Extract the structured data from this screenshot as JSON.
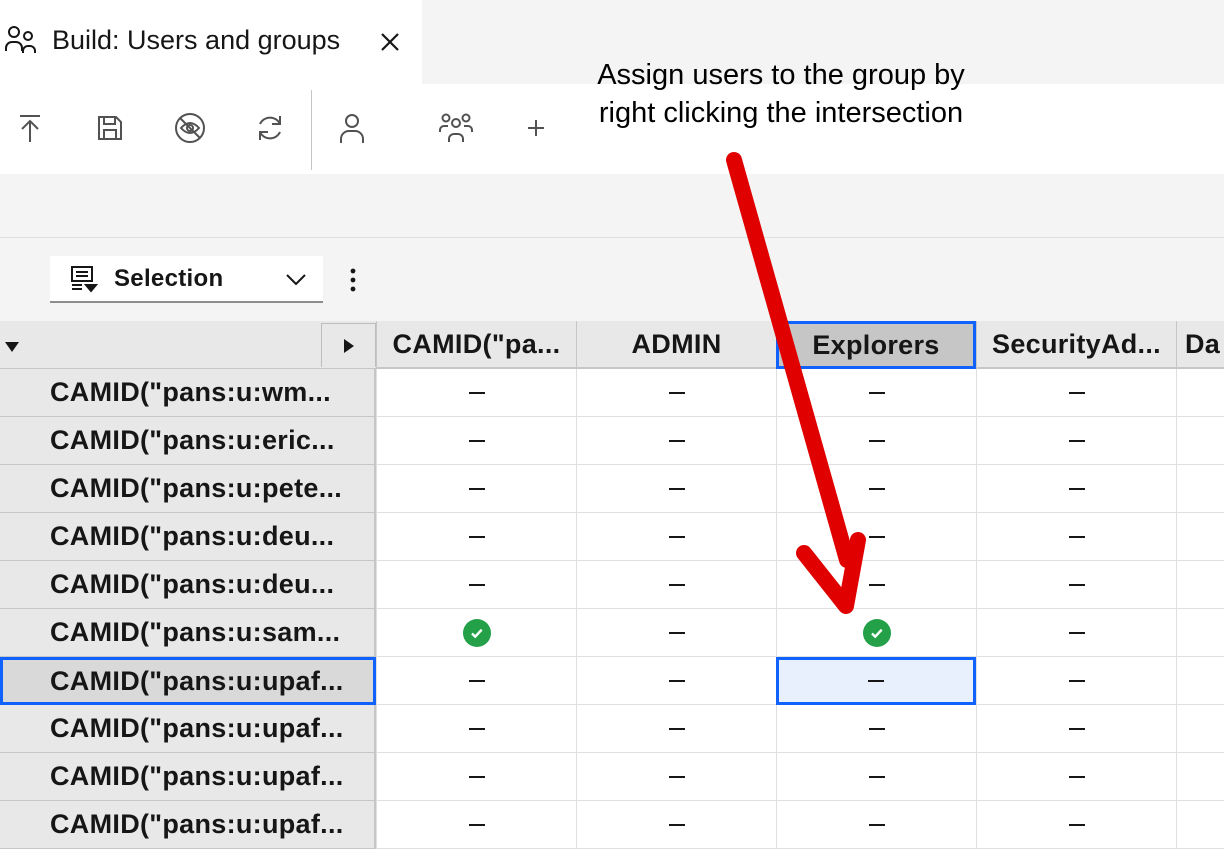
{
  "tab": {
    "title": "Build: Users and groups",
    "icon": "user-multiple-icon",
    "close_icon": "close-icon"
  },
  "toolbar": {
    "buttons": [
      {
        "icon": "upload-icon"
      },
      {
        "icon": "save-icon"
      },
      {
        "icon": "view-off-icon"
      },
      {
        "icon": "renew-icon"
      },
      {
        "icon": "user-icon"
      },
      {
        "icon": "group-icon"
      },
      {
        "icon": "add-icon"
      }
    ]
  },
  "annotation": {
    "text": "Assign users to the group by\nright clicking the intersection",
    "arrow_color": "#e00000"
  },
  "selector": {
    "label": "Selection",
    "icon": "list-filter-icon",
    "chevron": "chevron-down-icon",
    "overflow_icon": "overflow-menu-vertical-icon"
  },
  "grid": {
    "columns": [
      "CAMID(\"pa...",
      "ADMIN",
      "Explorers",
      "SecurityAd...",
      "Da"
    ],
    "selected_column": 2,
    "rows": [
      {
        "label": "CAMID(\"pans:u:wm...",
        "cells": [
          "–",
          "–",
          "–",
          "–"
        ]
      },
      {
        "label": "CAMID(\"pans:u:eric...",
        "cells": [
          "–",
          "–",
          "–",
          "–"
        ]
      },
      {
        "label": "CAMID(\"pans:u:pete...",
        "cells": [
          "–",
          "–",
          "–",
          "–"
        ]
      },
      {
        "label": "CAMID(\"pans:u:deu...",
        "cells": [
          "–",
          "–",
          "–",
          "–"
        ]
      },
      {
        "label": "CAMID(\"pans:u:deu...",
        "cells": [
          "–",
          "–",
          "–",
          "–"
        ]
      },
      {
        "label": "CAMID(\"pans:u:sam...",
        "cells": [
          "check",
          "–",
          "check",
          "–"
        ]
      },
      {
        "label": "CAMID(\"pans:u:upaf...",
        "cells": [
          "–",
          "–",
          "–",
          "–"
        ]
      },
      {
        "label": "CAMID(\"pans:u:upaf...",
        "cells": [
          "–",
          "–",
          "–",
          "–"
        ]
      },
      {
        "label": "CAMID(\"pans:u:upaf...",
        "cells": [
          "–",
          "–",
          "–",
          "–"
        ]
      },
      {
        "label": "CAMID(\"pans:u:upaf...",
        "cells": [
          "–",
          "–",
          "–",
          "–"
        ]
      }
    ],
    "selected_row": 6,
    "check_color": "#24a148",
    "selection_color": "#0f62fe"
  }
}
